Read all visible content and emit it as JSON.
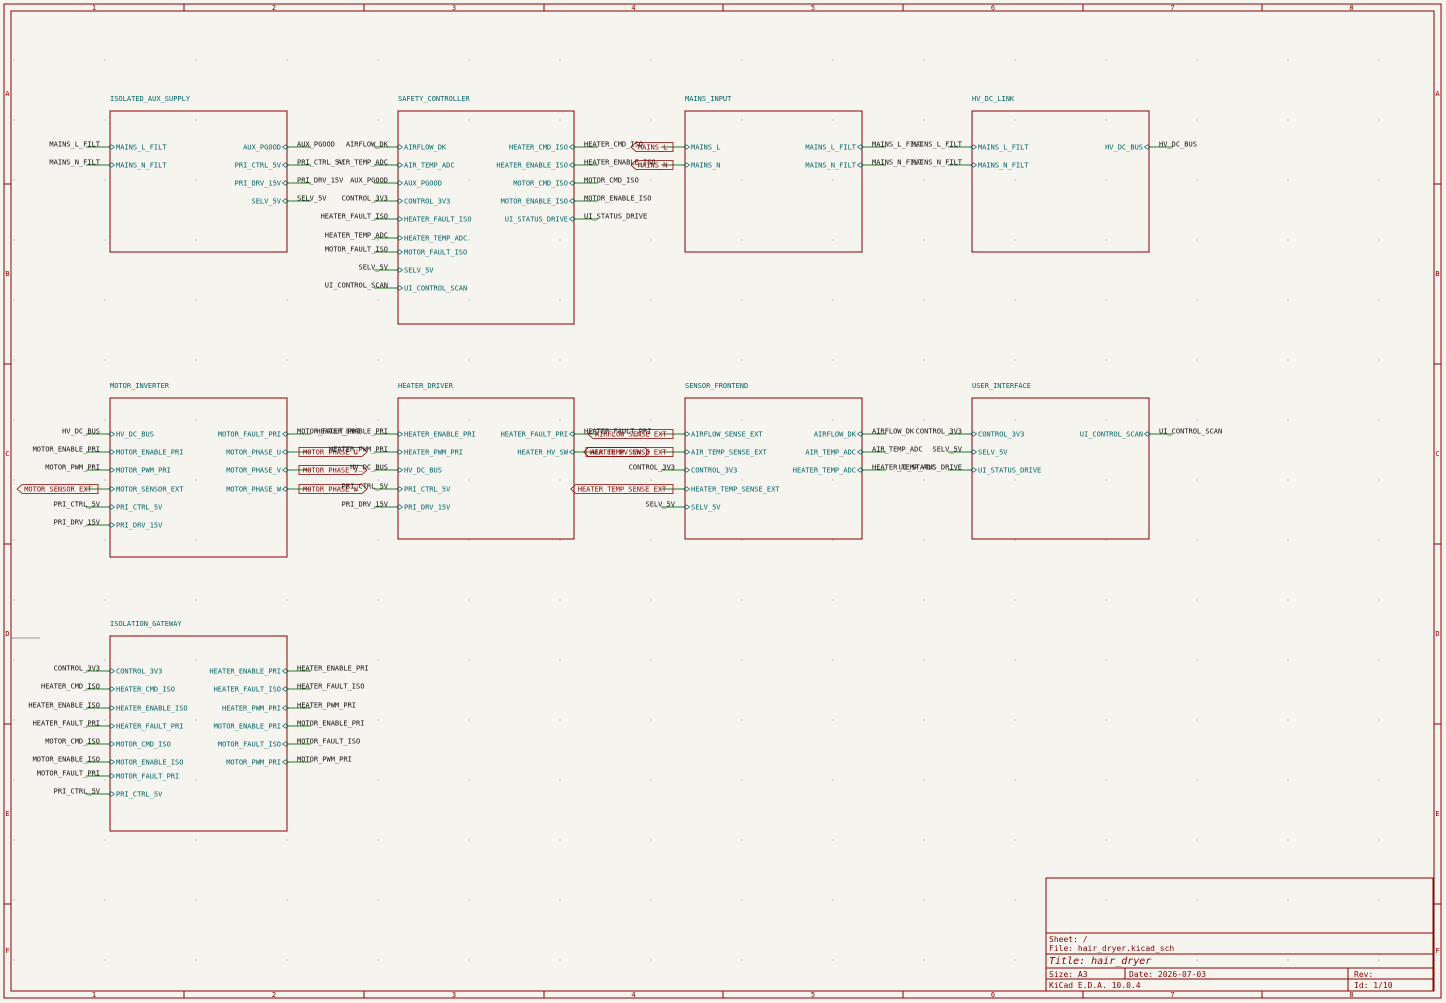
{
  "frame": {
    "columns": [
      "1",
      "2",
      "3",
      "4",
      "5",
      "6",
      "7",
      "8"
    ],
    "rows": [
      "A",
      "B",
      "C",
      "D",
      "E",
      "F"
    ]
  },
  "sheets": [
    {
      "name": "ISOLATED_AUX_SUPPLY",
      "left": [
        {
          "pin": "MAINS_L_FILT",
          "net": "MAINS_L_FILT"
        },
        {
          "pin": "MAINS_N_FILT",
          "net": "MAINS_N_FILT"
        }
      ],
      "right": [
        {
          "pin": "AUX_PGOOD",
          "net": "AUX_PGOOD"
        },
        {
          "pin": "PRI_CTRL_5V",
          "net": "PRI_CTRL_5V"
        },
        {
          "pin": "PRI_DRV_15V",
          "net": "PRI_DRV_15V"
        },
        {
          "pin": "SELV_5V",
          "net": "SELV_5V"
        }
      ]
    },
    {
      "name": "SAFETY_CONTROLLER",
      "left": [
        {
          "pin": "AIRFLOW_DK",
          "net": "AIRFLOW_DK"
        },
        {
          "pin": "AIR_TEMP_ADC",
          "net": "AIR_TEMP_ADC"
        },
        {
          "pin": "AUX_PGOOD",
          "net": "AUX_PGOOD"
        },
        {
          "pin": "CONTROL_3V3",
          "net": "CONTROL_3V3"
        },
        {
          "pin": "HEATER_FAULT_ISO",
          "net": "HEATER_FAULT_ISO"
        },
        {
          "pin": "HEATER_TEMP_ADC",
          "net": "HEATER_TEMP_ADC"
        },
        {
          "pin": "MOTOR_FAULT_ISO",
          "net": "MOTOR_FAULT_ISO"
        },
        {
          "pin": "SELV_5V",
          "net": "SELV_5V"
        },
        {
          "pin": "UI_CONTROL_SCAN",
          "net": "UI_CONTROL_SCAN"
        }
      ],
      "right": [
        {
          "pin": "HEATER_CMD_ISO",
          "net": "HEATER_CMD_ISO"
        },
        {
          "pin": "HEATER_ENABLE_ISO",
          "net": "HEATER_ENABLE_ISO"
        },
        {
          "pin": "MOTOR_CMD_ISO",
          "net": "MOTOR_CMD_ISO"
        },
        {
          "pin": "MOTOR_ENABLE_ISO",
          "net": "MOTOR_ENABLE_ISO"
        },
        {
          "pin": "UI_STATUS_DRIVE",
          "net": "UI_STATUS_DRIVE"
        }
      ]
    },
    {
      "name": "MAINS_INPUT",
      "left": [
        {
          "pin": "MAINS_L",
          "glabel": "MAINS_L"
        },
        {
          "pin": "MAINS_N",
          "glabel": "MAINS_N"
        }
      ],
      "right": [
        {
          "pin": "MAINS_L_FILT",
          "net": "MAINS_L_FILT"
        },
        {
          "pin": "MAINS_N_FILT",
          "net": "MAINS_N_FILT"
        }
      ]
    },
    {
      "name": "HV_DC_LINK",
      "left": [
        {
          "pin": "MAINS_L_FILT",
          "net": "MAINS_L_FILT"
        },
        {
          "pin": "MAINS_N_FILT",
          "net": "MAINS_N_FILT"
        }
      ],
      "right": [
        {
          "pin": "HV_DC_BUS",
          "net": "HV_DC_BUS"
        }
      ]
    },
    {
      "name": "MOTOR_INVERTER",
      "left": [
        {
          "pin": "HV_DC_BUS",
          "net": "HV_DC_BUS"
        },
        {
          "pin": "MOTOR_ENABLE_PRI",
          "net": "MOTOR_ENABLE_PRI"
        },
        {
          "pin": "MOTOR_PWM_PRI",
          "net": "MOTOR_PWM_PRI"
        },
        {
          "pin": "MOTOR_SENSOR_EXT",
          "glabel": "MOTOR_SENSOR_EXT"
        },
        {
          "pin": "PRI_CTRL_5V",
          "net": "PRI_CTRL_5V"
        },
        {
          "pin": "PRI_DRV_15V",
          "net": "PRI_DRV_15V"
        }
      ],
      "right": [
        {
          "pin": "MOTOR_FAULT_PRI",
          "net": "MOTOR_FAULT_PRI"
        },
        {
          "pin": "MOTOR_PHASE_U",
          "glabel": "MOTOR_PHASE_U"
        },
        {
          "pin": "MOTOR_PHASE_V",
          "glabel": "MOTOR_PHASE_V"
        },
        {
          "pin": "MOTOR_PHASE_W",
          "glabel": "MOTOR_PHASE_W"
        }
      ]
    },
    {
      "name": "HEATER_DRIVER",
      "left": [
        {
          "pin": "HEATER_ENABLE_PRI",
          "net": "HEATER_ENABLE_PRI"
        },
        {
          "pin": "HEATER_PWM_PRI",
          "net": "HEATER_PWM_PRI"
        },
        {
          "pin": "HV_DC_BUS",
          "net": "HV_DC_BUS"
        },
        {
          "pin": "PRI_CTRL_5V",
          "net": "PRI_CTRL_5V"
        },
        {
          "pin": "PRI_DRV_15V",
          "net": "PRI_DRV_15V"
        }
      ],
      "right": [
        {
          "pin": "HEATER_FAULT_PRI",
          "net": "HEATER_FAULT_PRI"
        },
        {
          "pin": "HEATER_HV_SW",
          "glabel": "HEATER_HV_SW"
        }
      ]
    },
    {
      "name": "SENSOR_FRONTEND",
      "left": [
        {
          "pin": "AIRFLOW_SENSE_EXT",
          "glabel": "AIRFLOW_SENSE_EXT"
        },
        {
          "pin": "AIR_TEMP_SENSE_EXT",
          "glabel": "AIR_TEMP_SENSE_EXT"
        },
        {
          "pin": "CONTROL_3V3",
          "net": "CONTROL_3V3"
        },
        {
          "pin": "HEATER_TEMP_SENSE_EXT",
          "glabel": "HEATER_TEMP_SENSE_EXT"
        },
        {
          "pin": "SELV_5V",
          "net": "SELV_5V"
        }
      ],
      "right": [
        {
          "pin": "AIRFLOW_DK",
          "net": "AIRFLOW_DK"
        },
        {
          "pin": "AIR_TEMP_ADC",
          "net": "AIR_TEMP_ADC"
        },
        {
          "pin": "HEATER_TEMP_ADC",
          "net": "HEATER_TEMP_ADC"
        }
      ]
    },
    {
      "name": "USER_INTERFACE",
      "left": [
        {
          "pin": "CONTROL_3V3",
          "net": "CONTROL_3V3"
        },
        {
          "pin": "SELV_5V",
          "net": "SELV_5V"
        },
        {
          "pin": "UI_STATUS_DRIVE",
          "net": "UI_STATUS_DRIVE"
        }
      ],
      "right": [
        {
          "pin": "UI_CONTROL_SCAN",
          "net": "UI_CONTROL_SCAN"
        }
      ]
    },
    {
      "name": "ISOLATION_GATEWAY",
      "left": [
        {
          "pin": "CONTROL_3V3",
          "net": "CONTROL_3V3"
        },
        {
          "pin": "HEATER_CMD_ISO",
          "net": "HEATER_CMD_ISO"
        },
        {
          "pin": "HEATER_ENABLE_ISO",
          "net": "HEATER_ENABLE_ISO"
        },
        {
          "pin": "HEATER_FAULT_PRI",
          "net": "HEATER_FAULT_PRI"
        },
        {
          "pin": "MOTOR_CMD_ISO",
          "net": "MOTOR_CMD_ISO"
        },
        {
          "pin": "MOTOR_ENABLE_ISO",
          "net": "MOTOR_ENABLE_ISO"
        },
        {
          "pin": "MOTOR_FAULT_PRI",
          "net": "MOTOR_FAULT_PRI"
        },
        {
          "pin": "PRI_CTRL_5V",
          "net": "PRI_CTRL_5V"
        }
      ],
      "right": [
        {
          "pin": "HEATER_ENABLE_PRI",
          "net": "HEATER_ENABLE_PRI"
        },
        {
          "pin": "HEATER_FAULT_ISO",
          "net": "HEATER_FAULT_ISO"
        },
        {
          "pin": "HEATER_PWM_PRI",
          "net": "HEATER_PWM_PRI"
        },
        {
          "pin": "MOTOR_ENABLE_PRI",
          "net": "MOTOR_ENABLE_PRI"
        },
        {
          "pin": "MOTOR_FAULT_ISO",
          "net": "MOTOR_FAULT_ISO"
        },
        {
          "pin": "MOTOR_PWM_PRI",
          "net": "MOTOR_PWM_PRI"
        }
      ]
    }
  ],
  "title_block": {
    "sheet": "Sheet: /",
    "file": "File: hair_dryer.kicad_sch",
    "title": "Title: hair_dryer",
    "size": "Size: A3",
    "date": "Date: 2026-07-03",
    "rev": "Rev:",
    "tool": "KiCad E.D.A. 10.0.4",
    "id": "Id: 1/10"
  },
  "colors": {
    "background": "#f5f4ef",
    "frame": "#8c0000",
    "sheet_border": "#8c0000",
    "pin_text": "#006464",
    "wire": "#2a7a2a",
    "net_text": "#111111",
    "global_label": "#8c0000"
  }
}
